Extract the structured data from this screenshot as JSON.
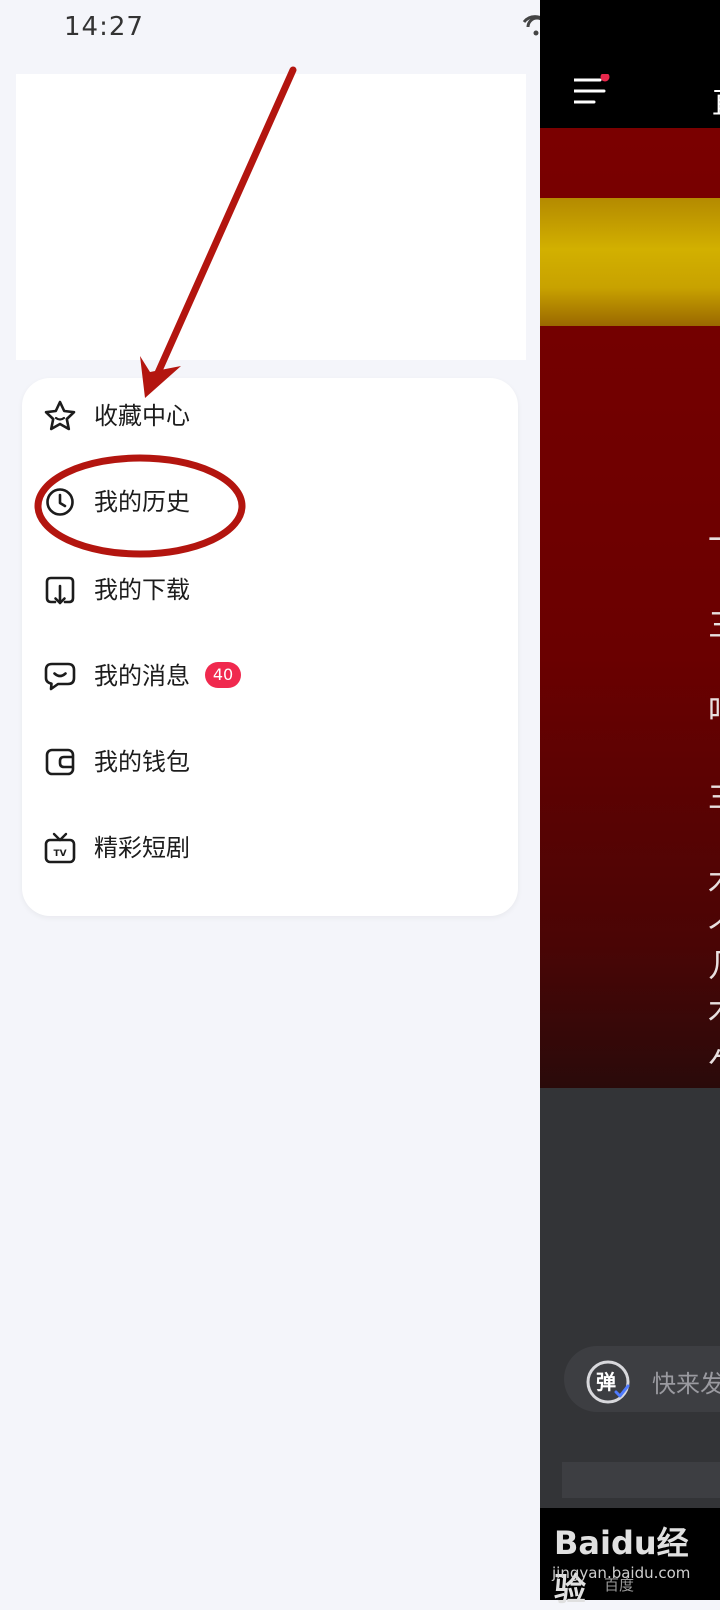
{
  "status": {
    "time": "14:27"
  },
  "menu": {
    "items": [
      {
        "label": "收藏中心",
        "icon": "star-icon"
      },
      {
        "label": "我的历史",
        "icon": "clock-icon"
      },
      {
        "label": "我的下载",
        "icon": "download-icon"
      },
      {
        "label": "我的消息",
        "icon": "message-icon",
        "badge": "40"
      },
      {
        "label": "我的钱包",
        "icon": "wallet-icon"
      },
      {
        "label": "精彩短剧",
        "icon": "tv-icon"
      }
    ]
  },
  "right_panel": {
    "title_partial": "直",
    "subtitle_chars": [
      "一",
      "三",
      "吗",
      "主",
      "木",
      "个",
      "几",
      "木",
      "乍"
    ],
    "danmu_placeholder": "快来发",
    "danmu_icon_text": "弹"
  },
  "watermark": {
    "logo": "Baidu经验",
    "site": "jingyan.baidu.com",
    "sub": "百度"
  },
  "colors": {
    "annotation": "#b3150f",
    "badge": "#f0294e",
    "video_red": "#6a0000",
    "video_yellow": "#d2b000"
  }
}
